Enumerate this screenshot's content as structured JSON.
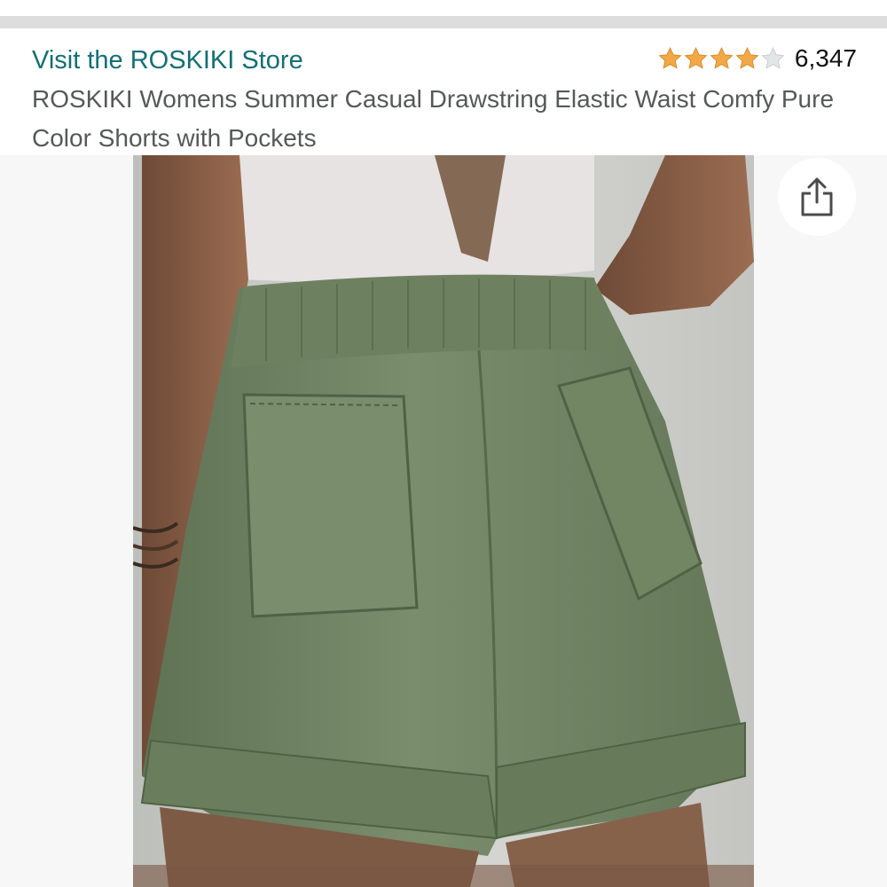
{
  "store": {
    "link_label": "Visit the ROSKIKI Store"
  },
  "rating": {
    "stars_filled": 4,
    "stars_max": 5,
    "count": "6,347",
    "star_color": "#f3a847",
    "star_empty_color": "#d5d9d9"
  },
  "product": {
    "title": "ROSKIKI Womens Summer Casual Drawstring Elastic Waist Comfy Pure Color Shorts with Pockets"
  },
  "image": {
    "subject": "sage green shorts with back pockets",
    "shorts_color": "#6f8363"
  },
  "actions": {
    "share_icon": "share-icon"
  },
  "colors": {
    "link": "#136f76",
    "title": "#565959"
  }
}
